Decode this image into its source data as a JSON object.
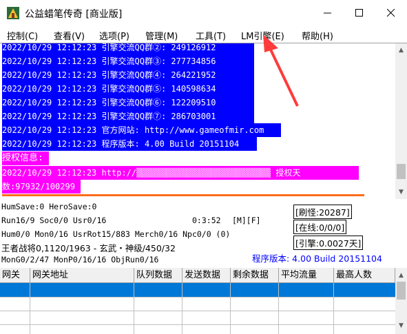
{
  "window": {
    "title": "公益蜡笔传奇 [商业版]",
    "min_glyph": "—",
    "max_glyph": "☐",
    "close_glyph": "✕"
  },
  "menu": [
    "控制(C)",
    "查看(V)",
    "选项(P)",
    "管理(M)",
    "工具(T)",
    "LM引擎(E)",
    "帮助(H)"
  ],
  "log": {
    "lines": [
      {
        "text": "2022/10/29 12:12:23 引擎交流QQ群②: 249126912",
        "style": "blue"
      },
      {
        "text": "2022/10/29 12:12:23 引擎交流QQ群③: 277734856",
        "style": "blue"
      },
      {
        "text": "2022/10/29 12:12:23 引擎交流QQ群④: 264221952",
        "style": "blue"
      },
      {
        "text": "2022/10/29 12:12:23 引擎交流QQ群⑤: 140598634",
        "style": "blue"
      },
      {
        "text": "2022/10/29 12:12:23 引擎交流QQ群⑥: 122209510",
        "style": "blue"
      },
      {
        "text": "2022/10/29 12:12:23 引擎交流QQ群⑦: 286703001",
        "style": "blue"
      },
      {
        "text": "2022/10/29 12:12:23 官方网站: http://www.gameofmir.com",
        "style": "blue"
      },
      {
        "text": "2022/10/29 12:12:23 程序版本: 4.00 Build 20151104",
        "style": "blue"
      },
      {
        "text": "授权信息:",
        "style": "magenta"
      },
      {
        "text": "2022/10/29 12:12:23 http://▒▒▒▒▒▒▒▒▒▒▒▒▒▒▒▒▒▒▒▒▒▒▒▒▒▒▒ 授权天",
        "style": "magenta"
      },
      {
        "text": "数:97932/100299",
        "style": "magenta"
      }
    ]
  },
  "status": {
    "line1": "HumSave:0 HeroSave:0",
    "line2": "Run16/9 Soc0/0 Usr0/16",
    "time": "0:3:52",
    "flags": "[M][F]",
    "line3": "Hum0/0 Mon0/16 UsrRot15/883 Merch0/16 Npc0/0 (0)",
    "line4": "王者战将0,1120/1963 - 玄武・神级/450/32",
    "line5": "MonG0/2/47 MonP0/16/16 ObjRun0/16",
    "refresh": "[刷怪:20287]",
    "online": "[在线:0/0/0]",
    "engine": "[引擎:0.0027天]",
    "version": "程序版本: 4.00 Build 20151104"
  },
  "grid": {
    "headers": [
      "网关",
      "网关地址",
      "队列数据",
      "发送数据",
      "剩余数据",
      "平均流量",
      "最高人数"
    ]
  },
  "colors": {
    "selection_blue": "#0000ff",
    "selection_magenta": "#ff00ff",
    "grid_selection": "#0078d7",
    "annotation_arrow": "#ff3b3b",
    "version_text": "#0000ff"
  }
}
